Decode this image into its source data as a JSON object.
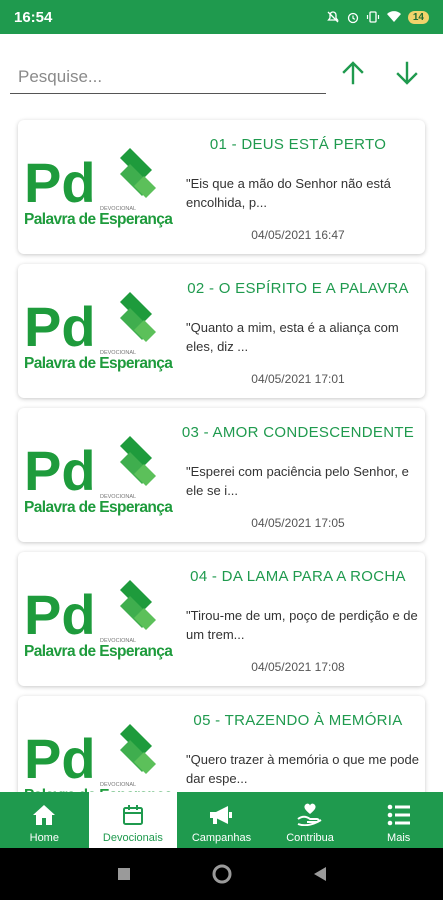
{
  "status_bar": {
    "time": "16:54",
    "battery": "14",
    "icons": [
      "mute-icon",
      "alarm-icon",
      "vibrate-icon",
      "wifi-icon",
      "battery-icon"
    ]
  },
  "search": {
    "placeholder": "Pesquise...",
    "value": ""
  },
  "sort": {
    "up_icon": "arrow-up-icon",
    "down_icon": "arrow-down-icon"
  },
  "colors": {
    "brand": "#1f9a4e",
    "logo_green": "#1e9b3c",
    "logo_light": "#5cc05a"
  },
  "logo": {
    "letters": "Pd",
    "small_text": "DEVOCIONAL",
    "tagline": "Palavra de Esperança"
  },
  "devotionals": [
    {
      "title": "01 - DEUS ESTÁ PERTO",
      "snippet": "\"Eis que a mão do Senhor não está encolhida, p...",
      "date": "04/05/2021 16:47"
    },
    {
      "title": "02 - O ESPÍRITO E A PALAVRA",
      "snippet": "\"Quanto a mim, esta é a aliança com eles, diz ...",
      "date": "04/05/2021 17:01"
    },
    {
      "title": "03 - AMOR CONDESCENDENTE",
      "snippet": "\"Esperei com paciência pelo Senhor, e ele se i...",
      "date": "04/05/2021 17:05"
    },
    {
      "title": "04 - DA LAMA PARA A ROCHA",
      "snippet": "\"Tirou-me de um, poço de perdição e de um trem...",
      "date": "04/05/2021 17:08"
    },
    {
      "title": "05 - TRAZENDO À MEMÓRIA",
      "snippet": "\"Quero trazer à memória o que me pode dar espe...",
      "date": ""
    }
  ],
  "bottom_nav": [
    {
      "label": "Home",
      "icon": "home-icon",
      "active": false
    },
    {
      "label": "Devocionais",
      "icon": "calendar-icon",
      "active": true
    },
    {
      "label": "Campanhas",
      "icon": "megaphone-icon",
      "active": false
    },
    {
      "label": "Contribua",
      "icon": "donate-icon",
      "active": false
    },
    {
      "label": "Mais",
      "icon": "menu-list-icon",
      "active": false
    }
  ],
  "system_nav": [
    "recents-icon",
    "home-circle-icon",
    "back-icon"
  ]
}
